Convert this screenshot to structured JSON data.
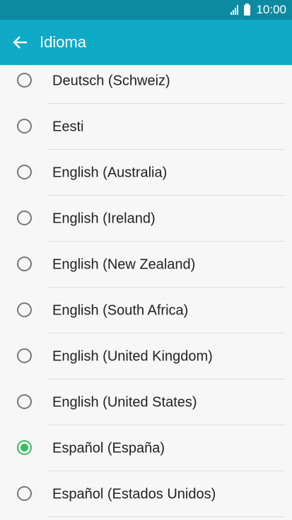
{
  "status_bar": {
    "time": "10:00"
  },
  "app_bar": {
    "title": "Idioma"
  },
  "languages": [
    {
      "label": "Deutsch (Schweiz)",
      "selected": false
    },
    {
      "label": "Eesti",
      "selected": false
    },
    {
      "label": "English (Australia)",
      "selected": false
    },
    {
      "label": "English (Ireland)",
      "selected": false
    },
    {
      "label": "English (New Zealand)",
      "selected": false
    },
    {
      "label": "English (South Africa)",
      "selected": false
    },
    {
      "label": "English (United Kingdom)",
      "selected": false
    },
    {
      "label": "English (United States)",
      "selected": false
    },
    {
      "label": "Español (España)",
      "selected": true
    },
    {
      "label": "Español (Estados Unidos)",
      "selected": false
    }
  ],
  "colors": {
    "status_bar": "#0e8aa0",
    "app_bar": "#10aac6",
    "radio_selected": "#3dbb63"
  }
}
